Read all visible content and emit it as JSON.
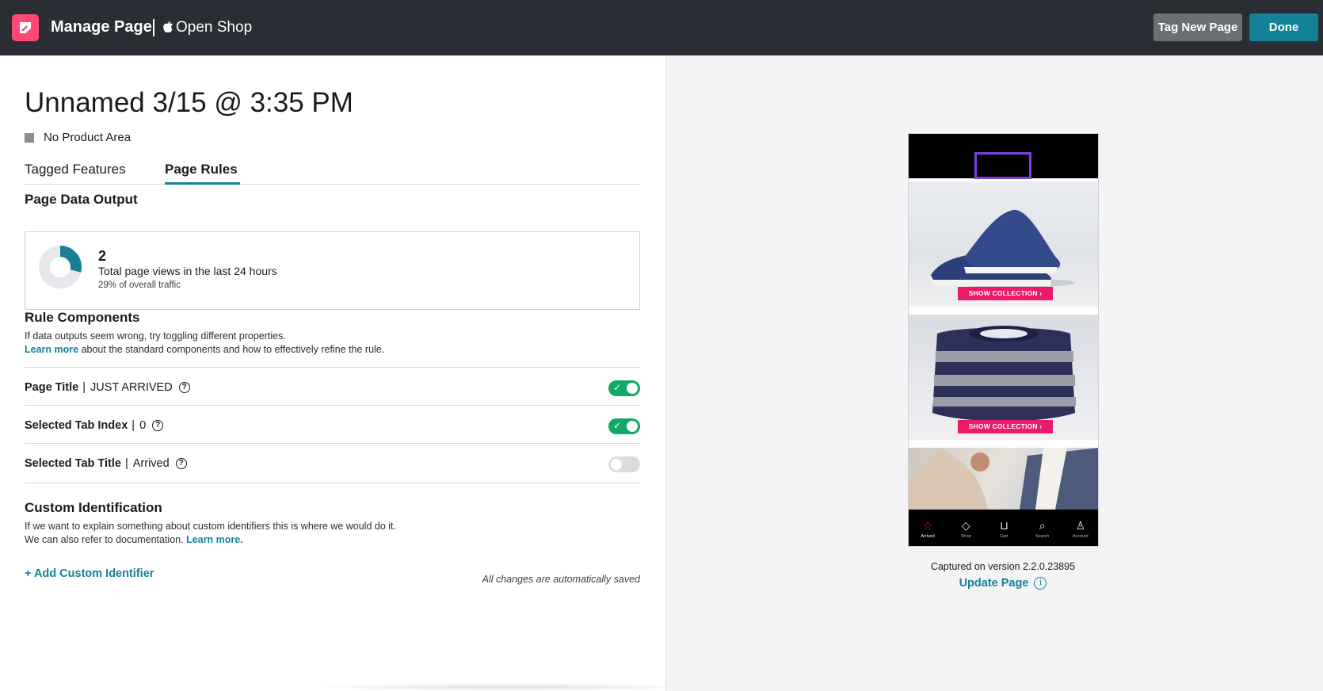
{
  "topbar": {
    "title": "Manage Page",
    "app_icon": "apple-icon",
    "app_name": "Open Shop",
    "tag_new_page_label": "Tag New Page",
    "done_label": "Done",
    "brand_color": "#ff4876",
    "accent_color": "#128297"
  },
  "page": {
    "title": "Unnamed 3/15 @ 3:35 PM",
    "product_area": "No Product Area"
  },
  "tabs": [
    {
      "label": "Tagged Features",
      "active": false
    },
    {
      "label": "Page Rules",
      "active": true
    }
  ],
  "output": {
    "heading": "Page Data Output",
    "count": "2",
    "label": "Total page views in the last 24 hours",
    "sub": "29% of overall traffic",
    "traffic_fraction": 0.29
  },
  "rules": {
    "heading": "Rule Components",
    "desc_line1": "If data outputs seem wrong, try toggling different properties.",
    "learn_more": "Learn more",
    "desc_line2_rest": "about the standard components and how to effectively refine the rule.",
    "items": [
      {
        "name": "Page Title",
        "value": "JUST ARRIVED",
        "enabled": true
      },
      {
        "name": "Selected Tab Index",
        "value": "0",
        "enabled": true
      },
      {
        "name": "Selected Tab Title",
        "value": "Arrived",
        "enabled": false
      }
    ]
  },
  "custom": {
    "heading": "Custom Identification",
    "desc_line1": "If we want to explain something about custom identifiers this is where we would do it.",
    "desc_line2": "We can also refer to documentation.",
    "learn_more": "Learn more.",
    "add_label": "+ Add Custom Identifier",
    "autosave": "All changes are automatically saved"
  },
  "preview": {
    "collection_button_1": "SHOW COLLECTION",
    "collection_button_2": "SHOW COLLECTION",
    "nav": [
      {
        "label": "Arrived",
        "icon": "star-icon",
        "active": true
      },
      {
        "label": "Shop",
        "icon": "tag-icon",
        "active": false
      },
      {
        "label": "Cart",
        "icon": "cart-icon",
        "active": false
      },
      {
        "label": "Search",
        "icon": "search-icon",
        "active": false
      },
      {
        "label": "Account",
        "icon": "user-icon",
        "active": false
      }
    ],
    "captured": "Captured on version 2.2.0.23895",
    "update_label": "Update Page"
  }
}
